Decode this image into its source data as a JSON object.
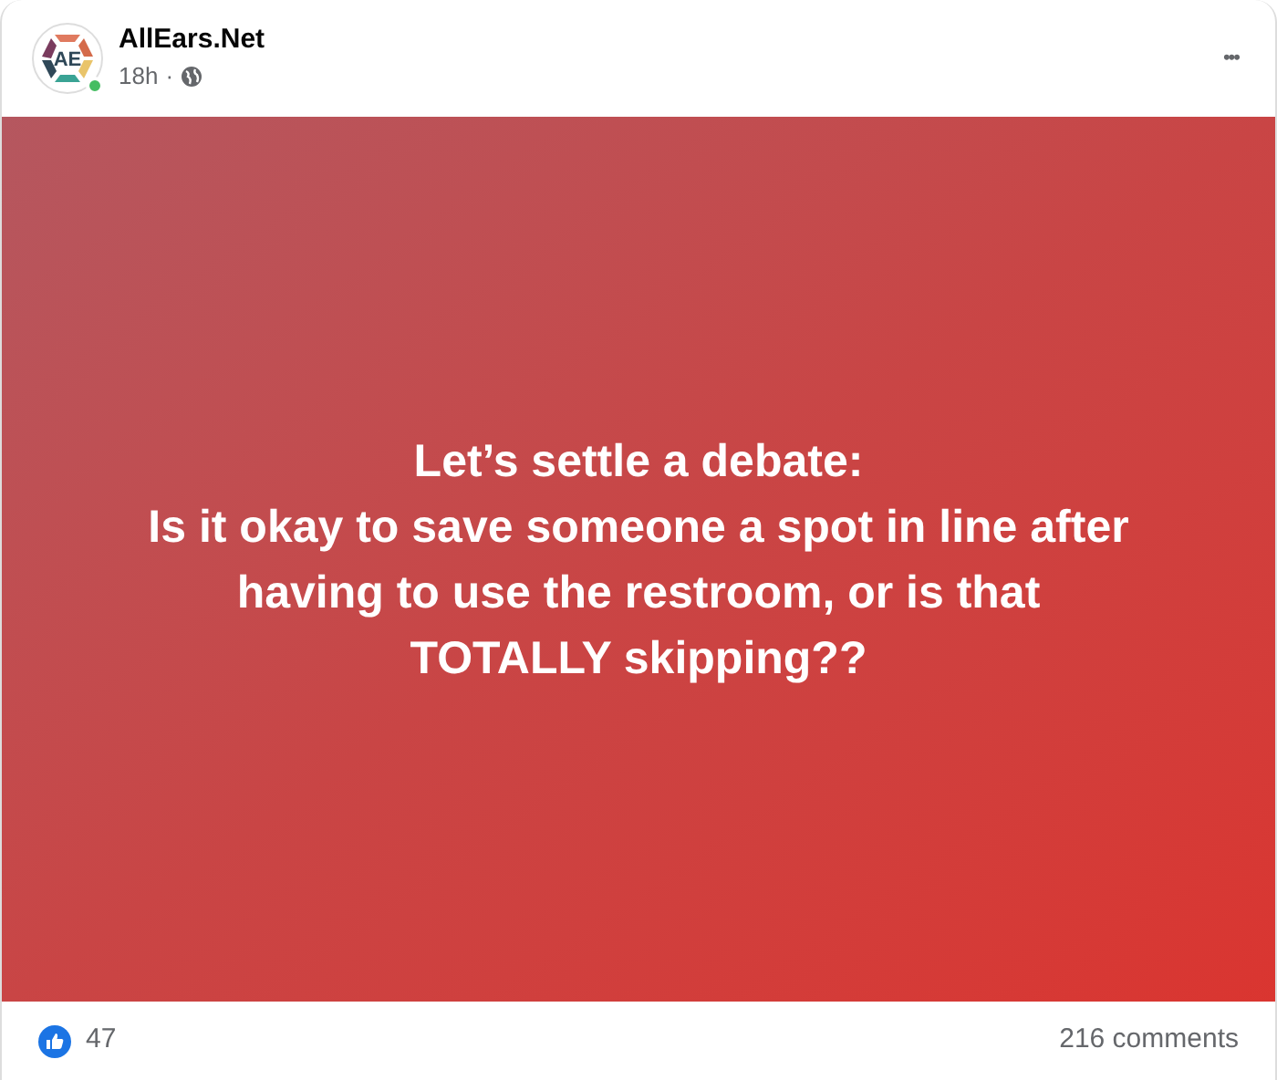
{
  "post": {
    "author": "AllEars.Net",
    "logo_text": "AE",
    "online": true,
    "time": "18h",
    "separator": "·",
    "more": "•••",
    "text_lines": [
      "Let’s settle a debate:",
      "Is it okay to save someone a spot in line after",
      "having to use the restroom, or is that",
      "TOTALLY skipping??"
    ],
    "reactions": "47",
    "comments": "216 comments"
  }
}
